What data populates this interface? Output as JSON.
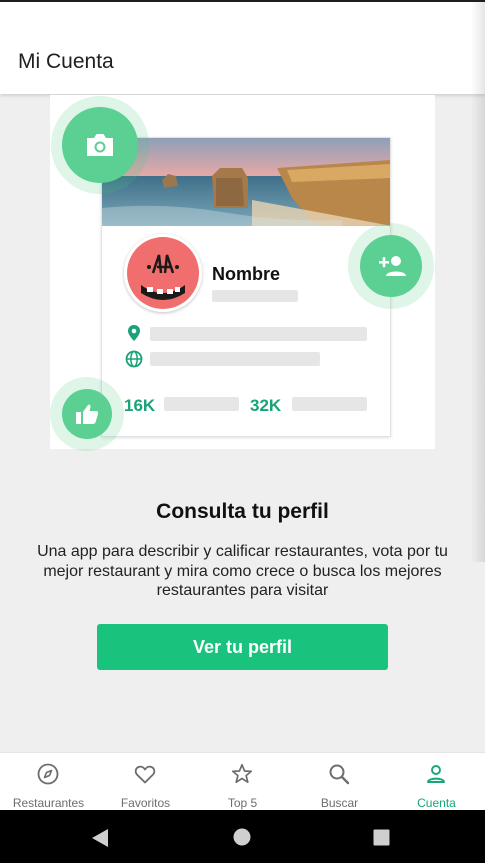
{
  "appbar": {
    "title": "Mi Cuenta"
  },
  "profile_card": {
    "name": "Nombre",
    "stat_followers": "16K",
    "stat_following": "32K"
  },
  "content": {
    "headline": "Consulta tu perfil",
    "description": "Una app para describir y calificar restaurantes, vota por tu mejor restaurant y mira como crece o busca los mejores restaurantes para visitar",
    "cta_label": "Ver tu perfil"
  },
  "bottom_nav": {
    "items": [
      {
        "label": "Restaurantes",
        "icon": "compass-icon",
        "active": false
      },
      {
        "label": "Favoritos",
        "icon": "heart-icon",
        "active": false
      },
      {
        "label": "Top 5",
        "icon": "star-icon",
        "active": false
      },
      {
        "label": "Buscar",
        "icon": "search-icon",
        "active": false
      },
      {
        "label": "Cuenta",
        "icon": "person-icon",
        "active": true
      }
    ]
  },
  "colors": {
    "accent": "#19c37d",
    "accent_text": "#16a874",
    "illustration_green": "#5ccf92",
    "avatar_red": "#f06e6e"
  }
}
